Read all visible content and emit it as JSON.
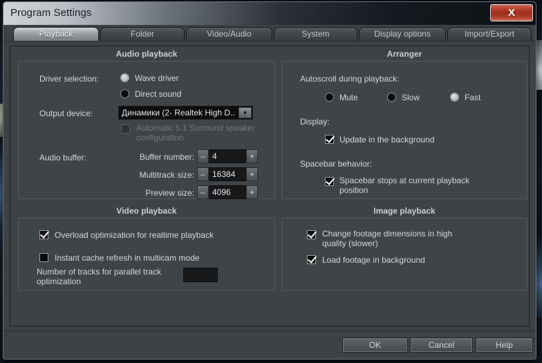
{
  "window": {
    "title": "Program Settings",
    "close_label": "X"
  },
  "tabs": [
    {
      "label": "Playback",
      "active": true
    },
    {
      "label": "Folder",
      "active": false
    },
    {
      "label": "Video/Audio",
      "active": false
    },
    {
      "label": "System",
      "active": false
    },
    {
      "label": "Display options",
      "active": false
    },
    {
      "label": "Import/Export",
      "active": false
    }
  ],
  "audio_playback": {
    "title": "Audio playback",
    "driver_selection_label": "Driver selection:",
    "driver_options": [
      {
        "label": "Wave driver",
        "selected": true
      },
      {
        "label": "Direct sound",
        "selected": false
      }
    ],
    "output_device_label": "Output device:",
    "output_device_value": "Динамики (2- Realtek High D...",
    "surround_label": "Automatic 5.1 Surround speaker configuration",
    "surround_checked": false,
    "surround_enabled": false,
    "audio_buffer_label": "Audio buffer:",
    "buffers": [
      {
        "label": "Buffer number:",
        "value": "4"
      },
      {
        "label": "Multitrack size:",
        "value": "16384"
      },
      {
        "label": "Preview size:",
        "value": "4096"
      }
    ],
    "spinner_minus": "–",
    "spinner_plus": "+"
  },
  "arranger": {
    "title": "Arranger",
    "autoscroll_label": "Autoscroll during playback:",
    "autoscroll_options": [
      {
        "label": "Mute",
        "selected": false
      },
      {
        "label": "Slow",
        "selected": false
      },
      {
        "label": "Fast",
        "selected": true
      }
    ],
    "display_label": "Display:",
    "update_background_label": "Update in the background",
    "update_background_checked": true,
    "spacebar_label": "Spacebar behavior:",
    "spacebar_option_label": "Spacebar stops at current playback position",
    "spacebar_option_checked": true
  },
  "video_playback": {
    "title": "Video playback",
    "overload_label": "Overload optimization for realtime playback",
    "overload_checked": true,
    "instant_cache_label": "Instant cache refresh in multicam mode",
    "instant_cache_checked": false,
    "tracks_label": "Number of tracks for parallel track optimization",
    "tracks_value": ""
  },
  "image_playback": {
    "title": "Image playback",
    "change_dimensions_label": "Change footage dimensions in high quality (slower)",
    "change_dimensions_checked": true,
    "load_background_label": "Load footage in background",
    "load_background_checked": true
  },
  "footer": {
    "ok_label": "OK",
    "cancel_label": "Cancel",
    "help_label": "Help"
  },
  "colors": {
    "dialog_background": "#3f4245",
    "panel_background": "#414447",
    "panel_border": "#54585c",
    "text": "#d2d6da",
    "accent_close": "#9e2d1b",
    "active_tab": "#a9aeb2"
  }
}
